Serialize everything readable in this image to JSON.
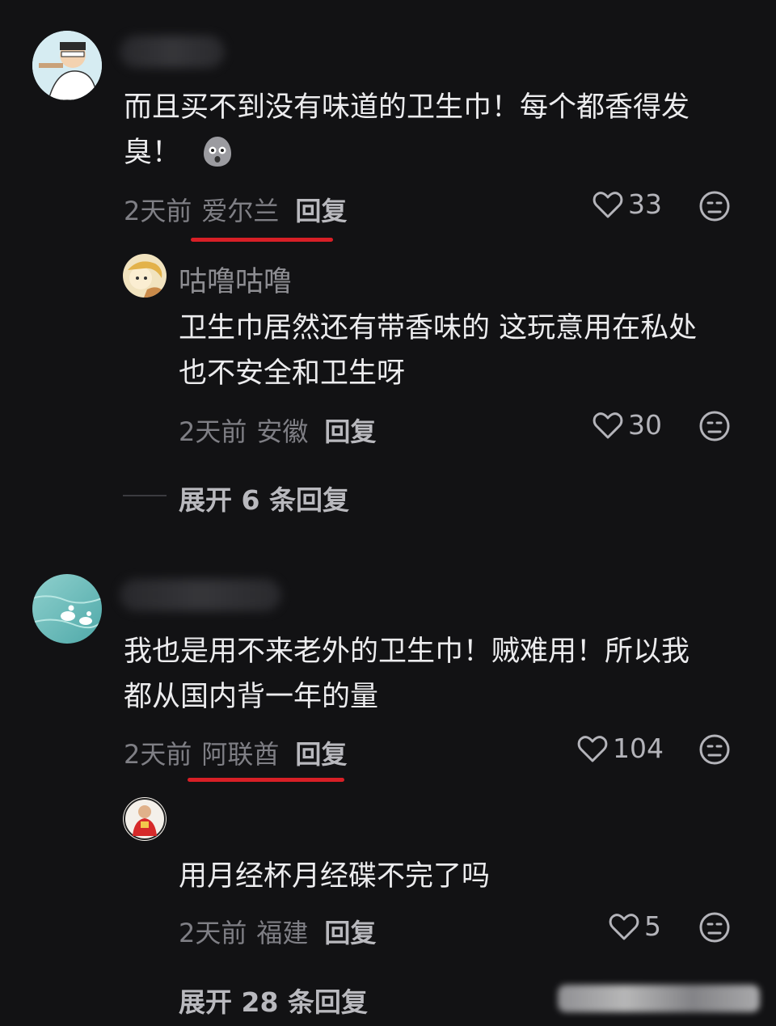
{
  "comments": [
    {
      "text_line1": "而且买不到没有味道的卫生巾！每个都香得发",
      "text_line2": "臭！",
      "time": "2天前",
      "location": "爱尔兰",
      "reply_label": "回复",
      "likes": "33",
      "reply": {
        "username": "咕噜咕噜",
        "text_line1": "卫生巾居然还有带香味的 这玩意用在私处",
        "text_line2": "也不安全和卫生呀",
        "time": "2天前",
        "location": "安徽",
        "reply_label": "回复",
        "likes": "30"
      },
      "expand_label": "展开 6 条回复"
    },
    {
      "text_line1": "我也是用不来老外的卫生巾！贼难用！所以我",
      "text_line2": "都从国内背一年的量",
      "time": "2天前",
      "location": "阿联酋",
      "reply_label": "回复",
      "likes": "104",
      "reply": {
        "text_line1": "用月经杯月经碟不完了吗",
        "time": "2天前",
        "location": "福建",
        "reply_label": "回复",
        "likes": "5"
      },
      "expand_label": "展开 28 条回复"
    }
  ],
  "icons": {
    "like": "heart-outline-icon",
    "dislike": "neutral-face-icon",
    "emoji": "shocked-face-emoji"
  },
  "colors": {
    "background": "#121214",
    "underline": "#d81f26"
  }
}
